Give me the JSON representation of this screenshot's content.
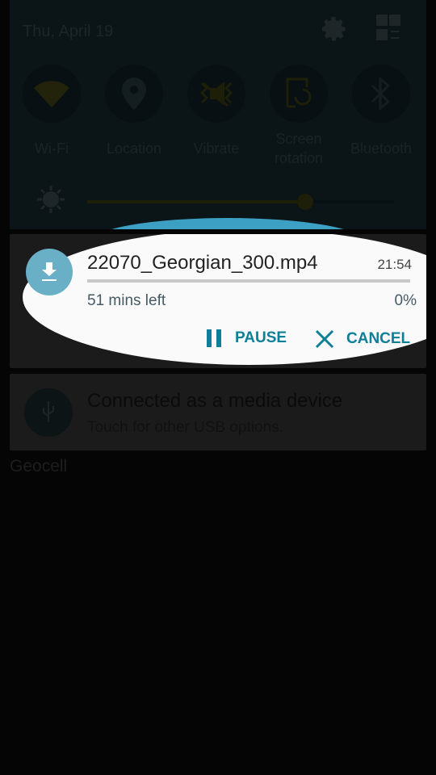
{
  "quick_panel": {
    "date": "Thu, April 19",
    "toggles": [
      {
        "label": "Wi-Fi",
        "icon": "wifi-icon"
      },
      {
        "label": "Location",
        "icon": "location-icon"
      },
      {
        "label": "Vibrate",
        "icon": "vibrate-icon"
      },
      {
        "label": "Screen rotation",
        "line1": "Screen",
        "line2": "rotation",
        "icon": "screen-rotation-icon"
      },
      {
        "label": "Bluetooth",
        "icon": "bluetooth-icon"
      }
    ],
    "brightness_percent": 71
  },
  "download": {
    "filename": "22070_Georgian_300.mp4",
    "time": "21:54",
    "remaining": "51 mins left",
    "percent": "0%",
    "progress": 0,
    "pause_label": "PAUSE",
    "cancel_label": "CANCEL"
  },
  "usb": {
    "title": "Connected as a media device",
    "subtitle": "Touch for other USB options."
  },
  "carrier": "Geocell",
  "colors": {
    "accent": "#0d7f97",
    "icon_bg": "#69afc5"
  }
}
